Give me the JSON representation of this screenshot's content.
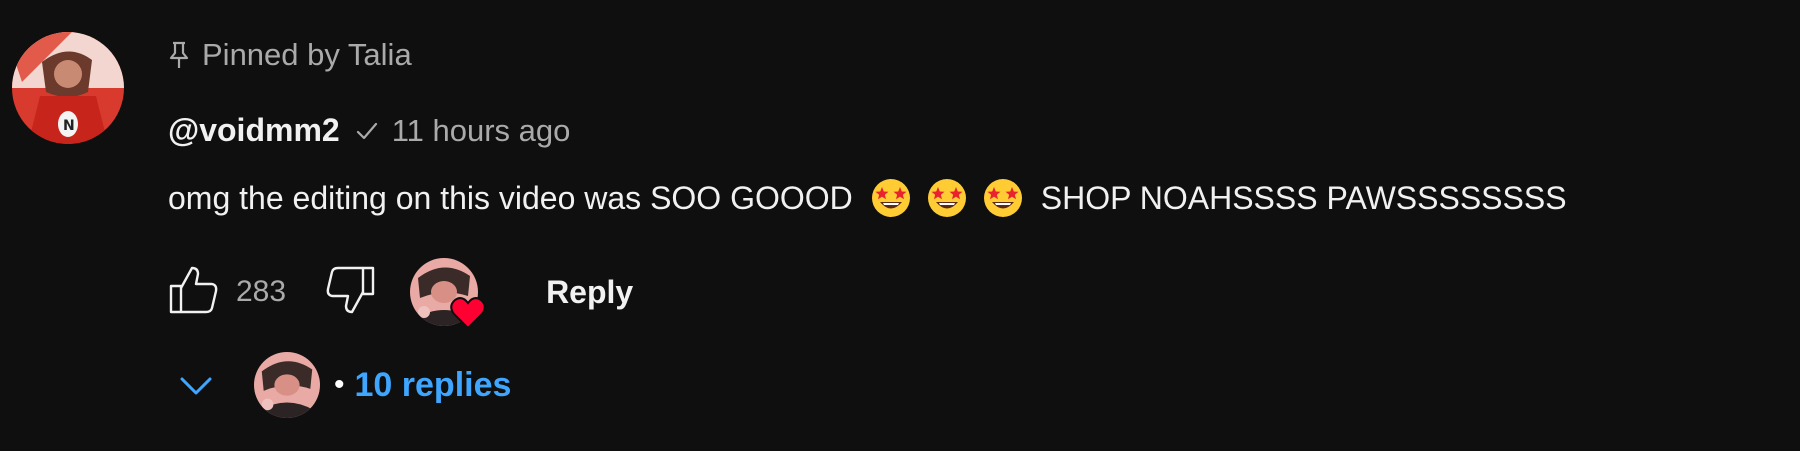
{
  "pinned": {
    "icon": "pin-icon",
    "label": "Pinned by Talia"
  },
  "comment": {
    "author": "@voidmm2",
    "verified_icon": "check-icon",
    "timestamp": "11 hours ago",
    "text_before": "omg the editing on this video was SOO GOOOD",
    "emoji": "star-struck-emoji",
    "emoji_count": 3,
    "text_after": "SHOP NOAHSSSS PAWSSSSSSSS"
  },
  "actions": {
    "like_icon": "thumbs-up-icon",
    "like_count": "283",
    "dislike_icon": "thumbs-down-icon",
    "creator_heart_icon": "heart-icon",
    "reply_label": "Reply"
  },
  "replies": {
    "chevron_icon": "chevron-down-icon",
    "separator": "•",
    "label": "10 replies"
  },
  "colors": {
    "background": "#0f0f0f",
    "primary_text": "#f1f1f1",
    "secondary_text": "#aaaaaa",
    "link_blue": "#3ea6ff",
    "heart_red": "#ff0033"
  }
}
